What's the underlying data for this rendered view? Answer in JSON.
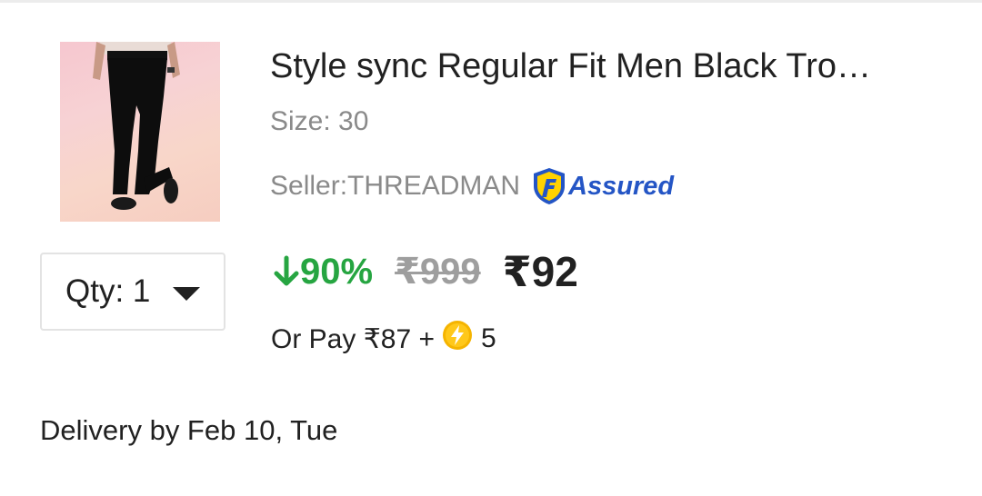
{
  "product": {
    "title": "Style sync Regular Fit Men Black Tro…",
    "size": "Size: 30",
    "seller": "Seller:THREADMAN",
    "assured_label": "Assured",
    "image_icon": "product-photo-black-trousers"
  },
  "pricing": {
    "discount": "90%",
    "mrp": "₹999",
    "price": "₹92",
    "or_pay_prefix": "Or Pay ₹87 +",
    "coins": "5",
    "discount_color": "#26a541",
    "assured_color": "#2455c5"
  },
  "quantity": {
    "label": "Qty: 1"
  },
  "delivery": {
    "text": "Delivery by Feb 10, Tue"
  }
}
